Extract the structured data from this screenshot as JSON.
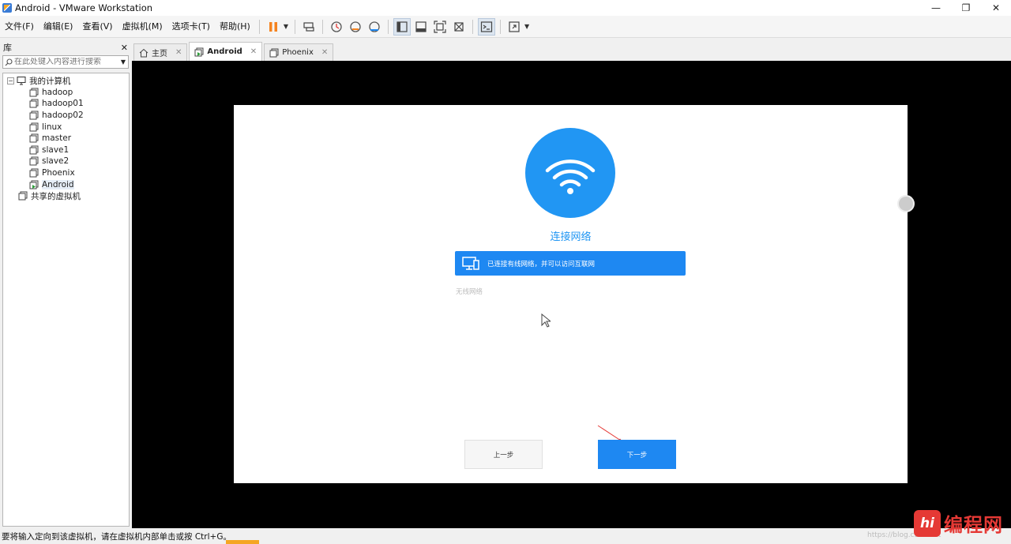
{
  "window": {
    "title": "Android - VMware Workstation",
    "controls": [
      "—",
      "❐",
      "✕"
    ]
  },
  "menu": [
    "文件(F)",
    "编辑(E)",
    "查看(V)",
    "虚拟机(M)",
    "选项卡(T)",
    "帮助(H)"
  ],
  "library": {
    "title": "库",
    "close": "✕",
    "search_placeholder": "在此处键入内容进行搜索",
    "root": "我的计算机",
    "vms": [
      "hadoop",
      "hadoop01",
      "hadoop02",
      "linux",
      "master",
      "slave1",
      "slave2",
      "Phoenix",
      "Android"
    ],
    "selected": "Android",
    "shared": "共享的虚拟机"
  },
  "tabs": [
    {
      "label": "主页",
      "close": "✕"
    },
    {
      "label": "Android",
      "close": "✕"
    },
    {
      "label": "Phoenix",
      "close": "✕"
    }
  ],
  "guest": {
    "title": "连接网络",
    "wired_status": "已连接有线网络，并可以访问互联网",
    "wireless_label": "无线网络",
    "prev_button": "上一步",
    "next_button": "下一步"
  },
  "status": {
    "message": "要将输入定向到该虚拟机，请在虚拟机内部单击或按 Ctrl+G。"
  },
  "watermark": {
    "logo": "hi",
    "text": "编程网",
    "url": "https://blog.csdn.net"
  },
  "colors": {
    "accent_blue": "#1e88f2",
    "pause_orange": "#f5831f",
    "watermark_red": "#e53935"
  }
}
